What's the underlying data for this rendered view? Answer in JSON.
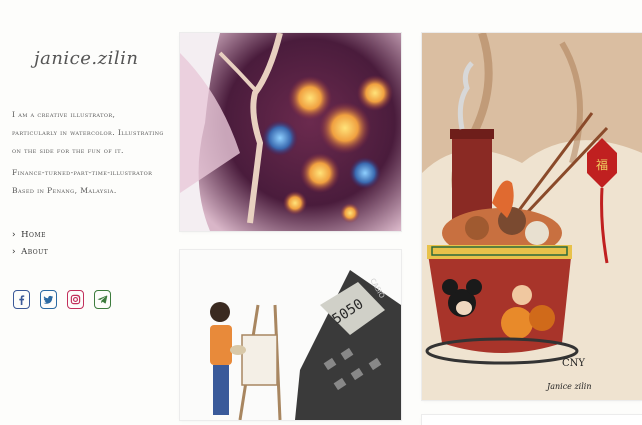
{
  "site": {
    "logo": "janice.zilin"
  },
  "bio": {
    "line1": "I am a creative illustrator,",
    "line2": "particularly in watercolor. Illustrating",
    "line3": "on the side for the fun of it.",
    "line4": "Finance-turned-part-time-illustrator",
    "line5": "Based in Penang, Malaysia."
  },
  "nav": {
    "home": "Home",
    "about": "About"
  },
  "social": [
    {
      "name": "facebook-icon",
      "color": "#3b5998"
    },
    {
      "name": "twitter-icon",
      "color": "#2b6aa3"
    },
    {
      "name": "instagram-icon",
      "color": "#c2305c"
    },
    {
      "name": "telegram-icon",
      "color": "#3d7c3d"
    }
  ],
  "artworks": {
    "cny_label": "CNY",
    "signature": "Janice zilin",
    "fu": "福",
    "calc_brand": "CASIO",
    "calc_display": "5050"
  }
}
